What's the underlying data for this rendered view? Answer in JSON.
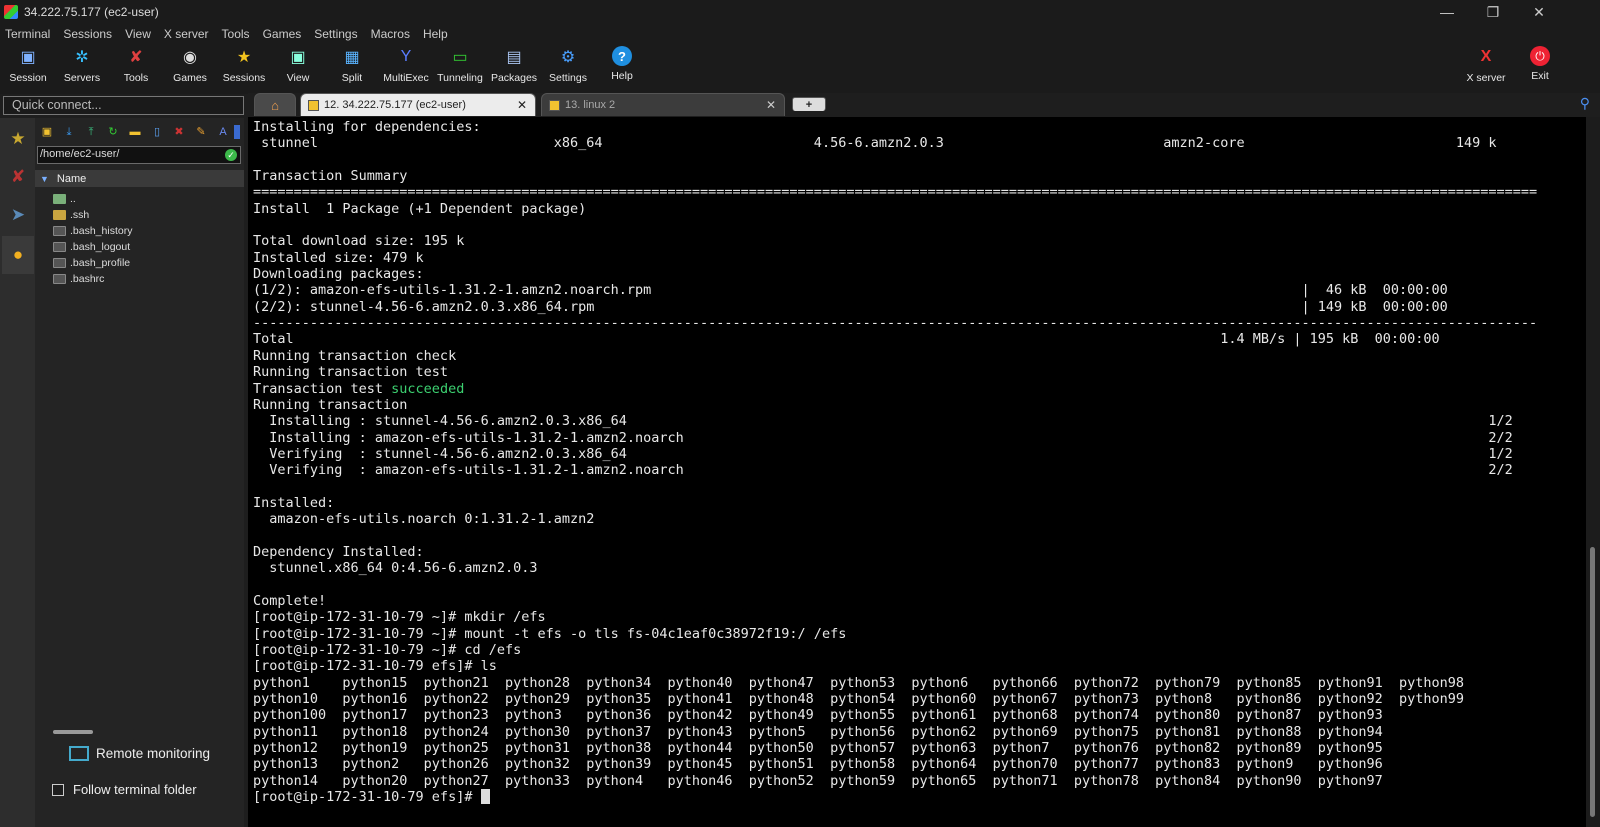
{
  "window": {
    "title": "34.222.75.177 (ec2-user)"
  },
  "menu": [
    "Terminal",
    "Sessions",
    "View",
    "X server",
    "Tools",
    "Games",
    "Settings",
    "Macros",
    "Help"
  ],
  "toolbar": {
    "session": "Session",
    "servers": "Servers",
    "tools": "Tools",
    "games": "Games",
    "sessions": "Sessions",
    "view": "View",
    "split": "Split",
    "multiexec": "MultiExec",
    "tunneling": "Tunneling",
    "packages": "Packages",
    "settings": "Settings",
    "help": "Help",
    "xserver": "X server",
    "exit": "Exit"
  },
  "quick_connect": {
    "placeholder": "Quick connect..."
  },
  "tabs": {
    "active": "12. 34.222.75.177 (ec2-user)",
    "inactive": "13. linux 2",
    "close": "✕",
    "add": "+"
  },
  "file_browser": {
    "path": "/home/ec2-user/",
    "column_name": "Name",
    "files": [
      "..",
      ".ssh",
      ".bash_history",
      ".bash_logout",
      ".bash_profile",
      ".bashrc"
    ],
    "remote_monitoring": "Remote monitoring",
    "follow_terminal_folder": "Follow terminal folder"
  },
  "terminal": {
    "lines": [
      "Installing for dependencies:",
      " stunnel                             x86_64                          4.56-6.amzn2.0.3                           amzn2-core                          149 k",
      "",
      "Transaction Summary",
      "==============================================================================================================================================================",
      "Install  1 Package (+1 Dependent package)",
      "",
      "Total download size: 195 k",
      "Installed size: 479 k",
      "Downloading packages:",
      "(1/2): amazon-efs-utils-1.31.2-1.amzn2.noarch.rpm                                                                                |  46 kB  00:00:00",
      "(2/2): stunnel-4.56-6.amzn2.0.3.x86_64.rpm                                                                                       | 149 kB  00:00:00",
      "--------------------------------------------------------------------------------------------------------------------------------------------------------------",
      "Total                                                                                                                  1.4 MB/s | 195 kB  00:00:00",
      "Running transaction check",
      "Running transaction test",
      "Transaction test ",
      "Running transaction",
      "  Installing : stunnel-4.56-6.amzn2.0.3.x86_64                                                                                                          1/2",
      "  Installing : amazon-efs-utils-1.31.2-1.amzn2.noarch                                                                                                   2/2",
      "  Verifying  : stunnel-4.56-6.amzn2.0.3.x86_64                                                                                                          1/2",
      "  Verifying  : amazon-efs-utils-1.31.2-1.amzn2.noarch                                                                                                   2/2",
      "",
      "Installed:",
      "  amazon-efs-utils.noarch 0:1.31.2-1.amzn2",
      "",
      "Dependency Installed:",
      "  stunnel.x86_64 0:4.56-6.amzn2.0.3",
      "",
      "Complete!",
      "[root@ip-172-31-10-79 ~]# mkdir /efs",
      "[root@ip-172-31-10-79 ~]# mount -t efs -o tls fs-04c1eaf0c38972f19:/ /efs",
      "[root@ip-172-31-10-79 ~]# cd /efs",
      "[root@ip-172-31-10-79 efs]# ls",
      "python1    python15  python21  python28  python34  python40  python47  python53  python6   python66  python72  python79  python85  python91  python98",
      "python10   python16  python22  python29  python35  python41  python48  python54  python60  python67  python73  python8   python86  python92  python99",
      "python100  python17  python23  python3   python36  python42  python49  python55  python61  python68  python74  python80  python87  python93",
      "python11   python18  python24  python30  python37  python43  python5   python56  python62  python69  python75  python81  python88  python94",
      "python12   python19  python25  python31  python38  python44  python50  python57  python63  python7   python76  python82  python89  python95",
      "python13   python2   python26  python32  python39  python45  python51  python58  python64  python70  python77  python83  python9   python96",
      "python14   python20  python27  python33  python4   python46  python52  python59  python65  python71  python78  python84  python90  python97",
      "[root@ip-172-31-10-79 efs]# "
    ],
    "succeeded": "succeeded"
  },
  "colors": {
    "accent_green": "#3cd070",
    "terminal_bg": "#000000",
    "ui_bg": "#1b1b1b"
  }
}
